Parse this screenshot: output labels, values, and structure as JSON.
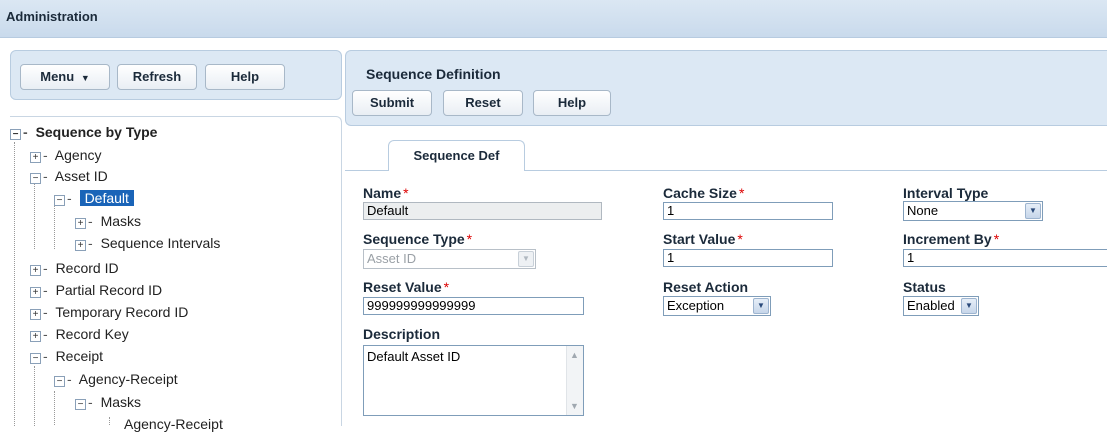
{
  "app": {
    "title": "Administration"
  },
  "left_toolbar": {
    "menu_label": "Menu",
    "menu_icon": "▼",
    "refresh_label": "Refresh",
    "help_label": "Help"
  },
  "tree": {
    "root": "Sequence by Type",
    "items": [
      {
        "label": "Agency"
      },
      {
        "label": "Asset ID"
      },
      {
        "label": "Default"
      },
      {
        "label": "Masks"
      },
      {
        "label": "Sequence Intervals"
      },
      {
        "label": "Record ID"
      },
      {
        "label": "Partial Record ID"
      },
      {
        "label": "Temporary Record ID"
      },
      {
        "label": "Record Key"
      },
      {
        "label": "Receipt"
      },
      {
        "label": "Agency-Receipt"
      },
      {
        "label": "Masks"
      },
      {
        "label": "Agency-Receipt"
      }
    ]
  },
  "header": {
    "title": "Sequence Definition",
    "submit_label": "Submit",
    "reset_label": "Reset",
    "help_label": "Help"
  },
  "tab": {
    "label": "Sequence Def"
  },
  "form": {
    "name": {
      "label": "Name",
      "value": "Default"
    },
    "sequence_type": {
      "label": "Sequence Type",
      "value": "Asset ID"
    },
    "reset_value": {
      "label": "Reset Value",
      "value": "999999999999999"
    },
    "description": {
      "label": "Description",
      "value": "Default Asset ID"
    },
    "cache_size": {
      "label": "Cache Size",
      "value": "1"
    },
    "start_value": {
      "label": "Start Value",
      "value": "1"
    },
    "reset_action": {
      "label": "Reset Action",
      "value": "Exception"
    },
    "interval_type": {
      "label": "Interval Type",
      "value": "None"
    },
    "increment_by": {
      "label": "Increment By",
      "value": "1"
    },
    "status": {
      "label": "Status",
      "value": "Enabled"
    },
    "required_mark": "*"
  },
  "colors": {
    "accent": "#1a64b8",
    "panel": "#dce8f4",
    "required": "#dd0000"
  }
}
